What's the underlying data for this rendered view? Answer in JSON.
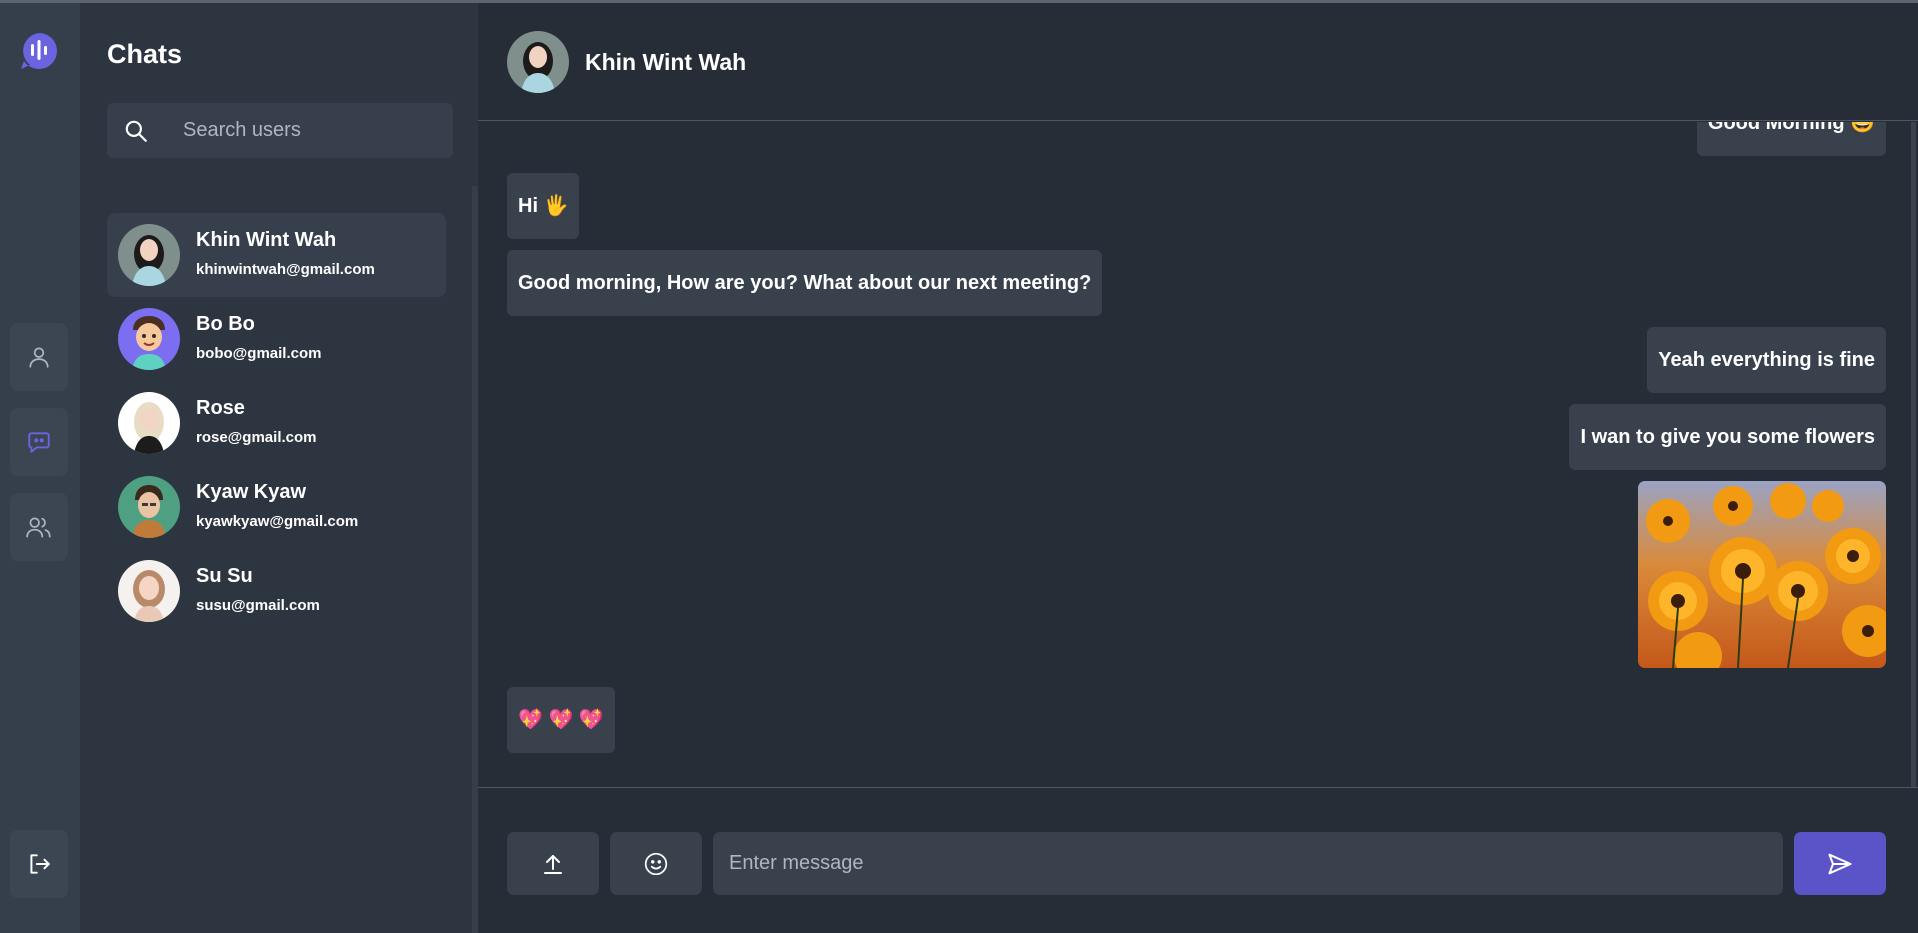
{
  "colors": {
    "accent": "#5b54c9",
    "rail_bg": "#353f4b",
    "panel_bg": "#2d3540",
    "main_bg": "#262d37",
    "bubble_bg": "#38414c"
  },
  "rail": {
    "logo_icon": "chat-waveform-logo",
    "items": [
      {
        "icon": "user-icon",
        "active": false
      },
      {
        "icon": "chat-bubble-icon",
        "active": true
      },
      {
        "icon": "users-group-icon",
        "active": false
      }
    ],
    "logout_icon": "logout-icon"
  },
  "sidebar": {
    "title": "Chats",
    "search_placeholder": "Search users",
    "contacts": [
      {
        "name": "Khin Wint Wah",
        "email": "khinwintwah@gmail.com",
        "active": true
      },
      {
        "name": "Bo Bo",
        "email": "bobo@gmail.com",
        "active": false
      },
      {
        "name": "Rose",
        "email": "rose@gmail.com",
        "active": false
      },
      {
        "name": "Kyaw Kyaw",
        "email": "kyawkyaw@gmail.com",
        "active": false
      },
      {
        "name": "Su Su",
        "email": "susu@gmail.com",
        "active": false
      }
    ]
  },
  "conversation": {
    "contact_name": "Khin Wint Wah",
    "messages": [
      {
        "direction": "out",
        "text": "Good Morning 🤩"
      },
      {
        "direction": "in",
        "text": "Hi 🖐"
      },
      {
        "direction": "in",
        "text": "Good morning, How are you? What about our next meeting?"
      },
      {
        "direction": "out",
        "text": "Yeah everything is fine"
      },
      {
        "direction": "out",
        "text": "I wan to give you some flowers"
      },
      {
        "direction": "out",
        "type": "image",
        "subject": "orange-flowers-photo"
      },
      {
        "direction": "in",
        "text": "💖 💖 💖"
      }
    ]
  },
  "composer": {
    "upload_icon": "upload-icon",
    "emoji_icon": "smiley-icon",
    "placeholder": "Enter message",
    "send_icon": "send-icon"
  }
}
